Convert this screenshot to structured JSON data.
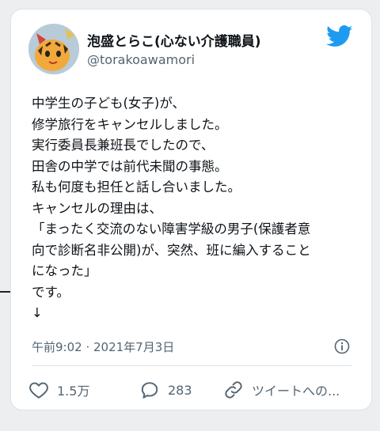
{
  "user": {
    "display_name": "泡盛とらこ(心ない介護職員)",
    "handle": "@torakoawamori"
  },
  "tweet": {
    "lines": [
      "中学生の子ども(女子)が、",
      "修学旅行をキャンセルしました。",
      "実行委員長兼班長でしたので、",
      "田舎の中学では前代未聞の事態。",
      "私も何度も担任と話し合いました。",
      "キャンセルの理由は、",
      "「まったく交流のない障害学級の男子(保護者意",
      "向で診断名非公開)が、突然、班に編入すること",
      "になった」",
      "です。",
      "↓"
    ],
    "timestamp": "午前9:02 · 2021年7月3日"
  },
  "actions": {
    "likes": "1.5万",
    "replies": "283",
    "share": "ツイートへの..."
  },
  "icons": {
    "bird": "twitter-bird-icon",
    "info": "info-icon",
    "like": "heart-icon",
    "reply": "reply-bubble-icon",
    "share": "link-icon"
  },
  "colors": {
    "twitter_blue": "#1d9bf0",
    "text": "#0f1419",
    "muted": "#536471"
  }
}
